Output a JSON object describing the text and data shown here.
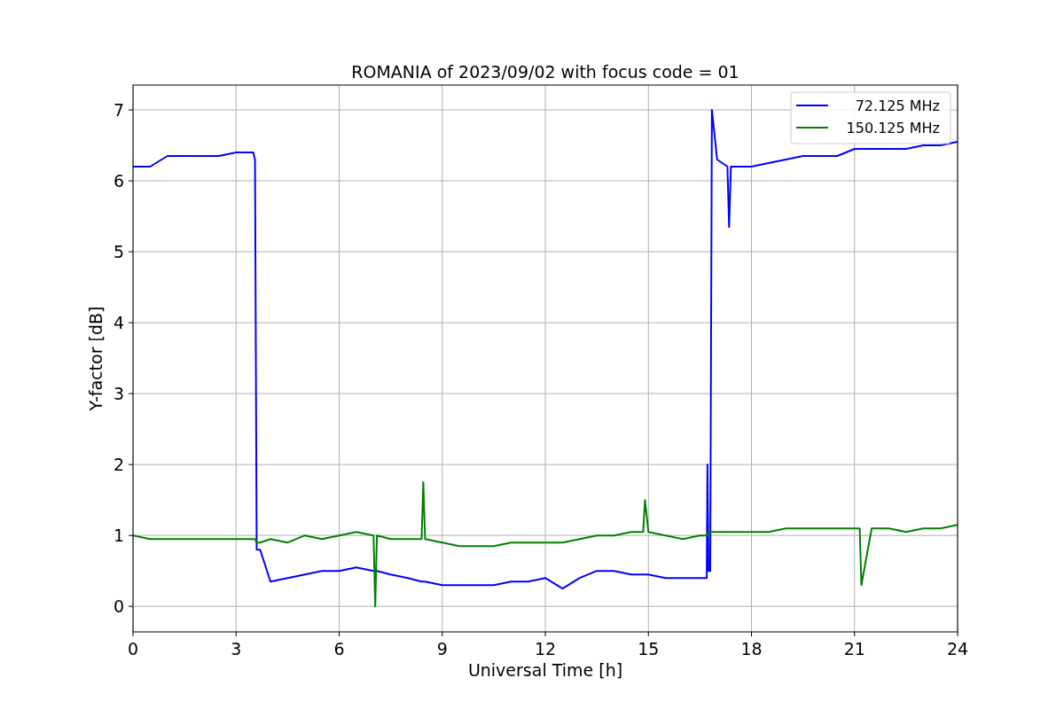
{
  "figure": {
    "chart_data": {
      "type": "line",
      "title": "ROMANIA of 2023/09/02 with focus code = 01",
      "xlabel": "Universal Time [h]",
      "ylabel": "Y-factor [dB]",
      "x": [
        0,
        0.5,
        1,
        1.5,
        2,
        2.5,
        3,
        3.5,
        3.55,
        3.6,
        3.7,
        4,
        4.5,
        5,
        5.5,
        6,
        6.5,
        7,
        7.05,
        7.1,
        7.5,
        8,
        8.4,
        8.45,
        8.5,
        9,
        9.5,
        10,
        10.5,
        11,
        11.5,
        12,
        12.5,
        13,
        13.5,
        14,
        14.5,
        14.85,
        14.9,
        15,
        15.5,
        16,
        16.5,
        16.7,
        16.72,
        16.75,
        16.8,
        16.85,
        17,
        17.3,
        17.35,
        17.4,
        17.5,
        18,
        18.5,
        19,
        19.5,
        20,
        20.5,
        21,
        21.15,
        21.2,
        21.5,
        22,
        22.5,
        23,
        23.5,
        24
      ],
      "series": [
        {
          "name": "72.125 MHz",
          "color": "#0000ff",
          "values": [
            6.2,
            6.2,
            6.35,
            6.35,
            6.35,
            6.35,
            6.4,
            6.4,
            6.3,
            0.8,
            0.8,
            0.35,
            0.4,
            0.45,
            0.5,
            0.5,
            0.55,
            0.5,
            0.5,
            0.5,
            0.45,
            0.4,
            0.35,
            0.35,
            0.35,
            0.3,
            0.3,
            0.3,
            0.3,
            0.35,
            0.35,
            0.4,
            0.25,
            0.4,
            0.5,
            0.5,
            0.45,
            0.45,
            0.45,
            0.45,
            0.4,
            0.4,
            0.4,
            0.4,
            2.0,
            0.5,
            0.5,
            7.0,
            6.3,
            6.2,
            5.35,
            6.2,
            6.2,
            6.2,
            6.25,
            6.3,
            6.35,
            6.35,
            6.35,
            6.45,
            6.45,
            6.45,
            6.45,
            6.45,
            6.45,
            6.5,
            6.5,
            6.55
          ]
        },
        {
          "name": "150.125 MHz",
          "color": "#008000",
          "values": [
            1.0,
            0.95,
            0.95,
            0.95,
            0.95,
            0.95,
            0.95,
            0.95,
            0.95,
            0.9,
            0.9,
            0.95,
            0.9,
            1.0,
            0.95,
            1.0,
            1.05,
            1.0,
            0.0,
            1.0,
            0.95,
            0.95,
            0.95,
            1.75,
            0.95,
            0.9,
            0.85,
            0.85,
            0.85,
            0.9,
            0.9,
            0.9,
            0.9,
            0.95,
            1.0,
            1.0,
            1.05,
            1.05,
            1.5,
            1.05,
            1.0,
            0.95,
            1.0,
            1.0,
            1.0,
            1.05,
            1.05,
            1.05,
            1.05,
            1.05,
            1.05,
            1.05,
            1.05,
            1.05,
            1.05,
            1.1,
            1.1,
            1.1,
            1.1,
            1.1,
            1.1,
            0.3,
            1.1,
            1.1,
            1.05,
            1.1,
            1.1,
            1.15
          ]
        }
      ],
      "grid": true,
      "legend": true,
      "xlim": [
        0,
        24
      ],
      "ylim": [
        -0.36,
        7.35
      ],
      "xticks": [
        0,
        3,
        6,
        9,
        12,
        15,
        18,
        21,
        24
      ],
      "yticks": [
        0,
        1,
        2,
        3,
        4,
        5,
        6,
        7
      ]
    }
  }
}
